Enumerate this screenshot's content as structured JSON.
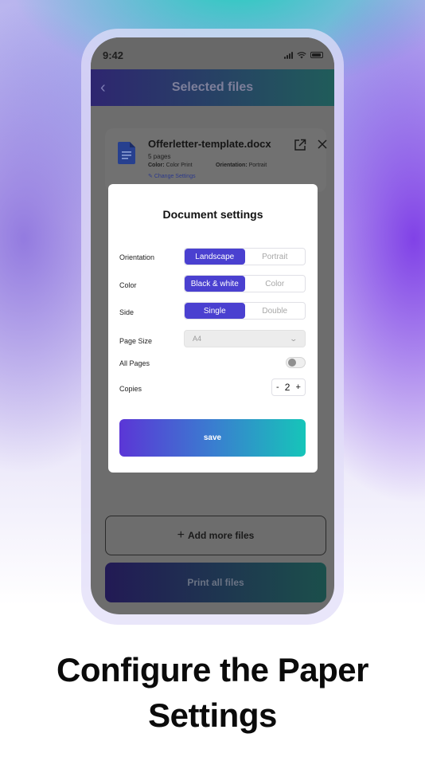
{
  "status_bar": {
    "time": "9:42"
  },
  "header": {
    "title": "Selected files"
  },
  "file": {
    "name": "Offerletter-template.docx",
    "pages": "5 pages",
    "color_label": "Color:",
    "color_value": "Color Print",
    "orientation_label": "Orientation:",
    "orientation_value": "Portrait",
    "change_settings": "Change Settings"
  },
  "modal": {
    "title": "Document settings",
    "orientation": {
      "label": "Orientation",
      "options": [
        "Landscape",
        "Portrait"
      ],
      "selected": "Landscape"
    },
    "color": {
      "label": "Color",
      "options": [
        "Black & white",
        "Color"
      ],
      "selected": "Black & white"
    },
    "side": {
      "label": "Side",
      "options": [
        "Single",
        "Double"
      ],
      "selected": "Single"
    },
    "page_size": {
      "label": "Page Size",
      "value": "A4"
    },
    "all_pages": {
      "label": "All Pages",
      "enabled": false
    },
    "copies": {
      "label": "Copies",
      "minus": "-",
      "value": "2",
      "plus": "+"
    },
    "save_label": "save"
  },
  "footer": {
    "add_files_label": "Add more files",
    "print_all_label": "Print all files"
  },
  "caption": {
    "line1": "Configure the Paper",
    "line2": "Settings"
  },
  "colors": {
    "accent": "#4a40d0",
    "gradient_start": "#5b36d6",
    "gradient_end": "#16c5b9"
  }
}
